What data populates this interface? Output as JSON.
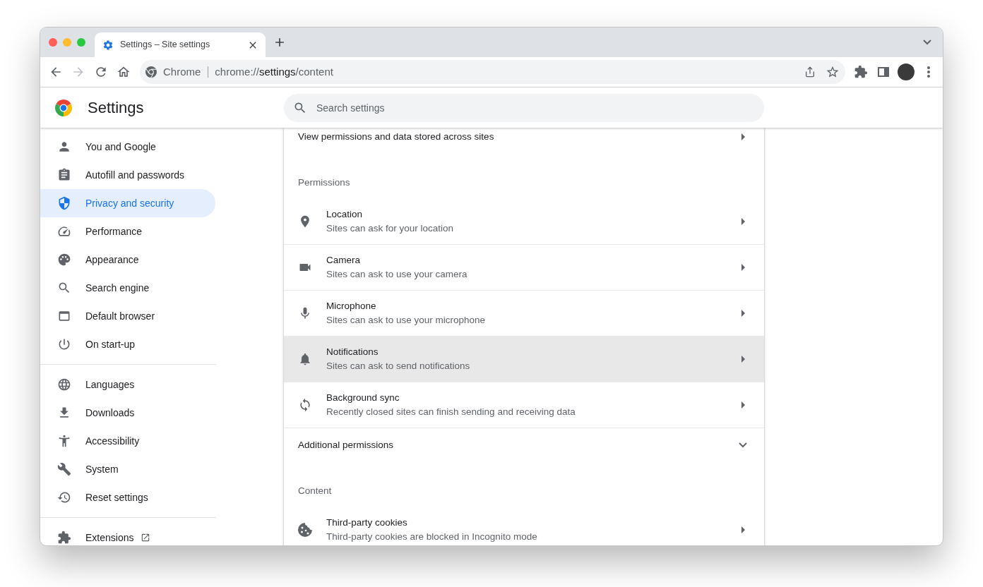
{
  "browser": {
    "tabs": [
      {
        "title": "Settings – Site settings",
        "selected": true
      }
    ],
    "nav_buttons": [
      {
        "kind": "back",
        "disabled": false
      },
      {
        "kind": "forward",
        "disabled": true
      }
    ],
    "address_bar": {
      "site_label": "Chrome",
      "url_scheme": "chrome://",
      "url_host": "settings",
      "url_path": "/content"
    }
  },
  "header": {
    "title": "Settings",
    "search": {
      "placeholder": "Search settings"
    }
  },
  "sidebar": {
    "groups": [
      {
        "items": [
          {
            "label": "You and Google",
            "selected": false
          },
          {
            "label": "Autofill and passwords",
            "selected": false
          },
          {
            "label": "Privacy and security",
            "selected": true
          },
          {
            "label": "Performance",
            "selected": false
          },
          {
            "label": "Appearance",
            "selected": false
          },
          {
            "label": "Search engine",
            "selected": false
          },
          {
            "label": "Default browser",
            "selected": false
          },
          {
            "label": "On start-up",
            "selected": false
          }
        ]
      },
      {
        "items": [
          {
            "label": "Languages",
            "selected": false
          },
          {
            "label": "Downloads",
            "selected": false
          },
          {
            "label": "Accessibility",
            "selected": false
          },
          {
            "label": "System",
            "selected": false
          },
          {
            "label": "Reset settings",
            "selected": false
          }
        ]
      },
      {
        "items": [
          {
            "label": "Extensions",
            "selected": false
          }
        ]
      }
    ]
  },
  "content": {
    "top_row": {
      "title": "View permissions and data stored across sites",
      "hovered": false
    },
    "sections": [
      {
        "heading": "Permissions",
        "rows": [
          {
            "kind": "link",
            "title": "Location",
            "subtitle": "Sites can ask for your location",
            "hovered": false
          },
          {
            "kind": "link",
            "title": "Camera",
            "subtitle": "Sites can ask to use your camera",
            "hovered": false
          },
          {
            "kind": "link",
            "title": "Microphone",
            "subtitle": "Sites can ask to use your microphone",
            "hovered": false
          },
          {
            "kind": "link",
            "title": "Notifications",
            "subtitle": "Sites can ask to send notifications",
            "hovered": true
          },
          {
            "kind": "link",
            "title": "Background sync",
            "subtitle": "Recently closed sites can finish sending and receiving data",
            "hovered": false
          },
          {
            "kind": "expander",
            "title": "Additional permissions",
            "expanded": false
          }
        ]
      },
      {
        "heading": "Content",
        "rows": [
          {
            "kind": "link",
            "title": "Third-party cookies",
            "subtitle": "Third-party cookies are blocked in Incognito mode",
            "hovered": false
          }
        ]
      }
    ]
  }
}
